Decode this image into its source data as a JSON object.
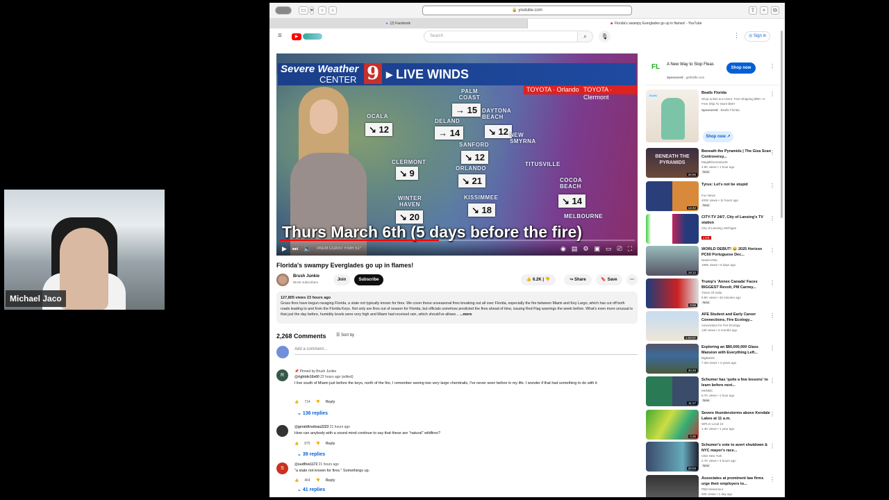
{
  "webcam": {
    "name": "Michael Jaco"
  },
  "browser": {
    "url": "youtube.com",
    "tabs": [
      {
        "label": "(2) Facebook",
        "active": false
      },
      {
        "label": "Florida's swampy Everglades go up in flames! - YouTube",
        "active": true
      }
    ]
  },
  "youtube": {
    "search_placeholder": "Search",
    "sign_in": "Sign in"
  },
  "video": {
    "banner": {
      "line1": "Severe Weather",
      "line2": "CENTER",
      "channel_number": "9",
      "title": "LIVE WINDS"
    },
    "sponsors": [
      "TOYOTA · Orlando",
      "TOYOTA · Clermont"
    ],
    "cities": [
      {
        "name": "PALM COAST",
        "wind": "→ 15"
      },
      {
        "name": "OCALA",
        "wind": "↘ 12"
      },
      {
        "name": "DELAND",
        "wind": "→ 14"
      },
      {
        "name": "DAYTONA BEACH",
        "wind": "↘ 12"
      },
      {
        "name": "NEW SMYRNA",
        "wind": ""
      },
      {
        "name": "SANFORD",
        "wind": "↘ 12"
      },
      {
        "name": "CLERMONT",
        "wind": "↘ 9"
      },
      {
        "name": "ORLANDO",
        "wind": "↘ 21"
      },
      {
        "name": "TITUSVILLE",
        "wind": ""
      },
      {
        "name": "KISSIMMEE",
        "wind": "↘ 18"
      },
      {
        "name": "WINTER HAVEN",
        "wind": "↘ 20"
      },
      {
        "name": "COCOA BEACH",
        "wind": "↘ 14"
      },
      {
        "name": "MELBOURNE",
        "wind": ""
      }
    ],
    "caption": "Thurs March 6th (5 days before the fire)",
    "progress_percent": 45,
    "bottom_ticker": "PALM COAST  FAIR 51°"
  },
  "title": "Florida's swampy Everglades go up in flames!",
  "channel": {
    "name": "Brush Junkie",
    "subscribers": "96.5K subscribers",
    "join": "Join",
    "subscribe": "Subscribe"
  },
  "actions": {
    "likes": "6.2K",
    "share": "Share",
    "save": "Save"
  },
  "description": {
    "stats": "127,805 views  23 hours ago",
    "text": "Grass fires have begun ravaging Florida, a state not typically known for fires. We cover these unseasonal fires breaking out all over Florida, especially the fire between Miami and Key Largo, which has cut off both roads leading to and from the Florida Keys. Not only are fires out of season for Florida, but officials somehow predicted the fires ahead of time, issuing Red Flag warnings the week before. What's even more unusual is that just the day before, humidity levels were very high and Miami had received rain, which should've allowe...",
    "more": "...more"
  },
  "comments": {
    "count": "2,268 Comments",
    "sort": "Sort by",
    "add_placeholder": "Add a comment...",
    "items": [
      {
        "pinned": "Pinned by Brush Junkie",
        "author": "@rightde10s60",
        "time": "22 hours ago (edited)",
        "text": "I live south of Miami just before the keys, north of the fire, I remember seeing two very large chemtrails, I've never seen before in my life. I wonder if that had something to do with it",
        "likes": "714",
        "reply": "Reply",
        "replies": "136 replies",
        "initial": "R",
        "color": "#37574a"
      },
      {
        "author": "@geraldtrudeau2223",
        "time": "21 hours ago",
        "text": "How can anybody with a sound mind continue to say that these are \"natural\" wildfires?",
        "likes": "875",
        "reply": "Reply",
        "replies": "39 replies",
        "initial": "",
        "color": "#333"
      },
      {
        "author": "@sudfive1172",
        "time": "21 hours ago",
        "text": "\"a state not known for fires.\" Somethings up.",
        "likes": "464",
        "reply": "Reply",
        "replies": "41 replies",
        "initial": "S",
        "color": "#c8321e"
      }
    ]
  },
  "sidebar": {
    "ad": {
      "logo": "FL",
      "title": "A New Way to Stop Fleas",
      "sponsored": "Sponsored",
      "domain": "getfutlife.com",
      "cta": "Shop now"
    },
    "ad2": {
      "title": "Bealls Florida",
      "desc": "Shop online & in-store. Free Shipping $99+ or Free Ship To Store $50+",
      "sponsored": "Sponsored",
      "advertiser": "Bealls Florida",
      "cta": "Shop now",
      "badge": "Bealls"
    },
    "videos": [
      {
        "title": "Beneath the Pyramids | The Giza Scan Controversy...",
        "channel": "MegalithomaniaUK",
        "views": "4.9K views • 1 hour ago",
        "badge": "New",
        "duration": "26:56",
        "thumb_text": "BENEATH THE PYRAMIDS",
        "thumb": "linear-gradient(#3a2e3e,#6b4a3a)"
      },
      {
        "title": "Tyrus: Let's not be stupid",
        "channel": "Fox News",
        "views": "400K views • 11 hours ago",
        "badge": "New",
        "duration": "14:42",
        "thumb": "linear-gradient(90deg,#2a3f7a 50%,#d88a3a 50%)"
      },
      {
        "title": "CITY-TV 24/7, City of Lansing's TV station",
        "channel": "City of Lansing, Michigan",
        "live": "LIVE",
        "thumb": "linear-gradient(90deg,#4c4 0%,#fff 10%,#fff 50%,#c0245c 50%,#243a7a 75%)"
      },
      {
        "title": "WORLD DEBUT! 😀 2025 Horizon PC60 Portuguese Dec...",
        "channel": "NauticVista",
        "views": "199K views • 8 days ago",
        "duration": "18:12",
        "thumb": "linear-gradient(#9bb,#556)"
      },
      {
        "title": "Trump's 'Annex Canada' Faces BIGGEST Revolt, PM Carney...",
        "channel": "Times Of India",
        "views": "6.9K views • 33 minutes ago",
        "badge": "New",
        "duration": "8:59",
        "thumb": "linear-gradient(90deg,#1d3c7a,#c22 60%,#ddd)"
      },
      {
        "title": "AFE Student and Early Career Connections, Fire Ecology...",
        "channel": "Association for Fire Ecology",
        "views": "130 views • 2 months ago",
        "duration": "1:00:07",
        "thumb": "linear-gradient(#cde 20%,#eee6d6)"
      },
      {
        "title": "Exploring an $80,000,000 Glass Mansion with Everything Left...",
        "channel": "BigBanks",
        "views": "7.3M views • 4 years ago",
        "duration": "30:29",
        "thumb": "linear-gradient(#556 0%,#3c6a9a 40%,#4a5a3a)"
      },
      {
        "title": "Schumer has 'quite a few lessons' to learn before next...",
        "channel": "MSNBC",
        "views": "8.7K views • 1 hour ago",
        "badge": "New",
        "duration": "11:17",
        "thumb": "linear-gradient(90deg,#2a7a55 50%,#3a4c6a 50%)"
      },
      {
        "title": "Severe thunderstorms above Kendale Lakes at 11 a.m.",
        "channel": "WPLG Local 10",
        "views": "1.4K views • 1 year ago",
        "duration": "0:30",
        "thumb": "linear-gradient(120deg,#4a3 0%,#cd4 40%,#3a7 70%,#c33)"
      },
      {
        "title": "Schumer's vote to avert shutdown & NYC mayor's race...",
        "channel": "CBS New York",
        "views": "2.7K views • 3 hours ago",
        "badge": "New",
        "duration": "28:03",
        "thumb": "linear-gradient(90deg,#3a4a6a,#6ab 70%,#223)"
      },
      {
        "title": "Associates at prominent law firms urge their employers to...",
        "channel": "PBS NewsHour",
        "views": "50K views • 1 day ago",
        "thumb": "linear-gradient(#333,#666)"
      }
    ]
  }
}
